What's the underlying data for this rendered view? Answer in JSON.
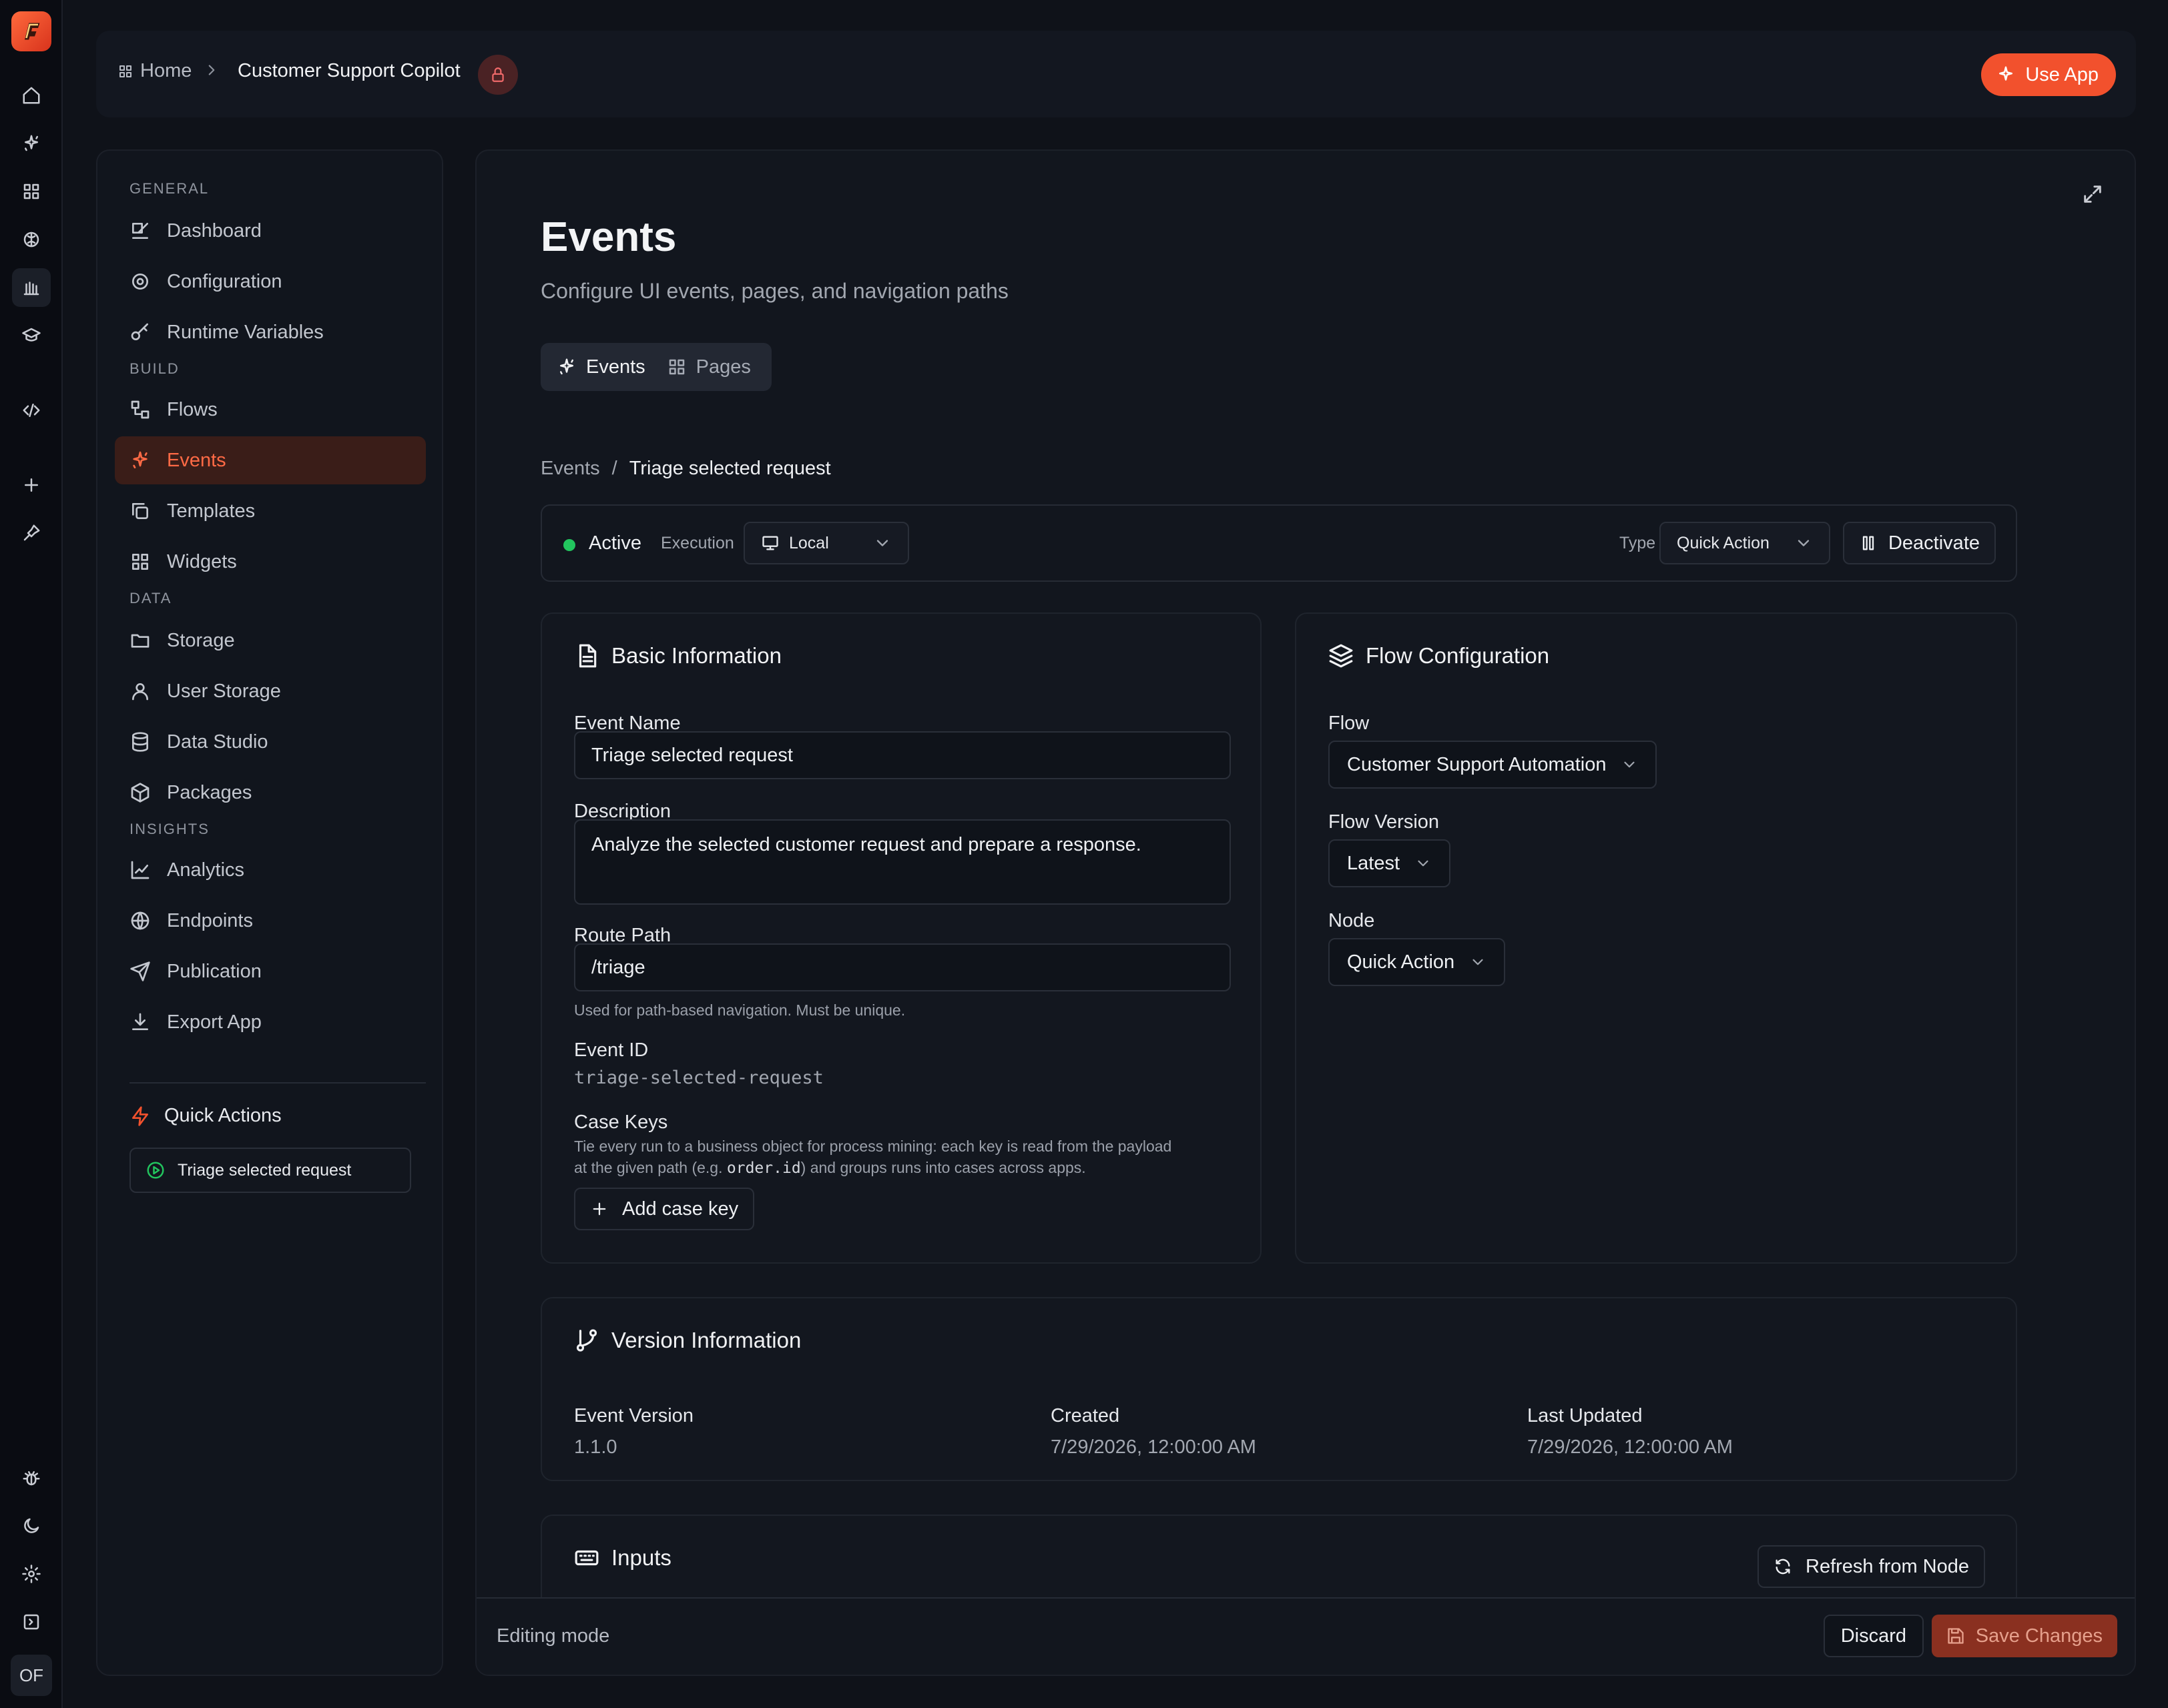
{
  "app": {
    "title": "Customer Support Copilot",
    "accent_color": "#f2512d",
    "use_app_label": "Use App"
  },
  "breadcrumb": {
    "home": "Home",
    "app": "Customer Support Copilot"
  },
  "rail": {
    "avatar_initials": "OF",
    "icons": [
      "home-icon",
      "sparkles-icon",
      "grid-icon",
      "brain-icon",
      "library-icon",
      "graduation-icon",
      "code-icon",
      "plus-icon",
      "pin-icon",
      "bug-icon",
      "moon-icon",
      "gear-icon",
      "panel-icon"
    ]
  },
  "sidebar": {
    "sections": {
      "general": "GENERAL",
      "build": "BUILD",
      "data": "DATA",
      "insights": "INSIGHTS"
    },
    "items": {
      "dashboard": "Dashboard",
      "configuration": "Configuration",
      "runtime_variables": "Runtime Variables",
      "flows": "Flows",
      "events": "Events",
      "templates": "Templates",
      "widgets": "Widgets",
      "storage": "Storage",
      "user_storage": "User Storage",
      "data_studio": "Data Studio",
      "packages": "Packages",
      "analytics": "Analytics",
      "endpoints": "Endpoints",
      "publication": "Publication",
      "export_app": "Export App"
    },
    "quick_actions": {
      "title": "Quick Actions",
      "items": [
        "Triage selected request"
      ]
    }
  },
  "main": {
    "title": "Events",
    "subtitle": "Configure UI events, pages, and navigation paths",
    "tabs": [
      "Events",
      "Pages"
    ],
    "breadcrumb": {
      "parent": "Events",
      "separator": "/",
      "current": "Triage selected request"
    },
    "status": {
      "state": "Active",
      "execution_label": "Execution",
      "execution_value": "Local",
      "type_label": "Type",
      "type_value": "Quick Action",
      "deactivate_label": "Deactivate"
    },
    "basic_info": {
      "title": "Basic Information",
      "event_name_label": "Event Name",
      "event_name": "Triage selected request",
      "description_label": "Description",
      "description": "Analyze the selected customer request and prepare a response.",
      "route_path_label": "Route Path",
      "route_path": "/triage",
      "route_path_hint": "Used for path-based navigation. Must be unique.",
      "event_id_label": "Event ID",
      "event_id": "triage-selected-request",
      "case_keys_label": "Case Keys",
      "case_keys_hint_1": "Tie every run to a business object for process mining: each key is read from the payload",
      "case_keys_hint_2a": "at the given path (e.g. ",
      "case_keys_hint_code": "order.id",
      "case_keys_hint_2b": ") and groups runs into cases across apps.",
      "add_case_key": "Add case key"
    },
    "flow_config": {
      "title": "Flow Configuration",
      "flow_label": "Flow",
      "flow_value": "Customer Support Automation",
      "version_label": "Flow Version",
      "version_value": "Latest",
      "node_label": "Node",
      "node_value": "Quick Action"
    },
    "version_info": {
      "title": "Version Information",
      "event_version_label": "Event Version",
      "event_version": "1.1.0",
      "created_label": "Created",
      "created": "7/29/2026, 12:00:00 AM",
      "updated_label": "Last Updated",
      "updated": "7/29/2026, 12:00:00 AM"
    },
    "inputs": {
      "title": "Inputs",
      "refresh_label": "Refresh from Node"
    },
    "footer": {
      "mode": "Editing mode",
      "discard": "Discard",
      "save": "Save Changes"
    }
  }
}
